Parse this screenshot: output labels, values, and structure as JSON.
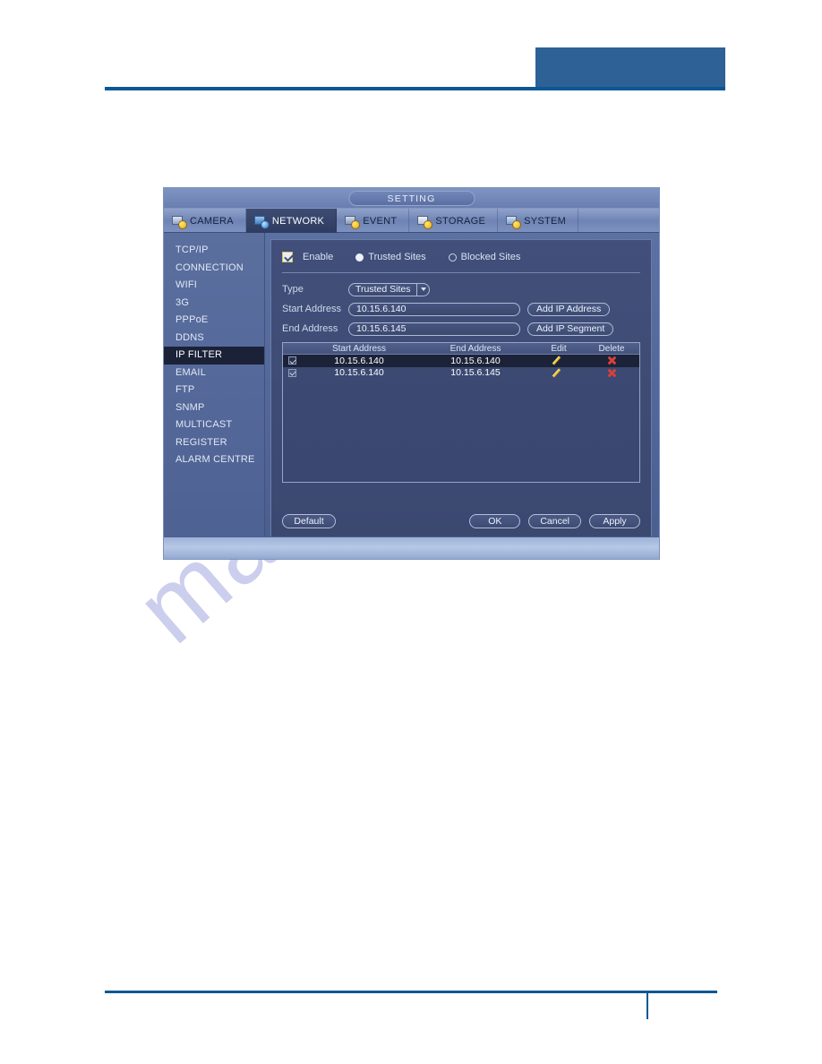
{
  "dialog": {
    "title": "SETTING",
    "tabs": [
      {
        "label": "CAMERA",
        "icon": "camera-icon",
        "active": false
      },
      {
        "label": "NETWORK",
        "icon": "network-icon",
        "active": true
      },
      {
        "label": "EVENT",
        "icon": "event-icon",
        "active": false
      },
      {
        "label": "STORAGE",
        "icon": "storage-icon",
        "active": false
      },
      {
        "label": "SYSTEM",
        "icon": "system-icon",
        "active": false
      }
    ],
    "sidebar": {
      "items": [
        {
          "label": "TCP/IP",
          "active": false
        },
        {
          "label": "CONNECTION",
          "active": false
        },
        {
          "label": "WIFI",
          "active": false
        },
        {
          "label": "3G",
          "active": false
        },
        {
          "label": "PPPoE",
          "active": false
        },
        {
          "label": "DDNS",
          "active": false
        },
        {
          "label": "IP FILTER",
          "active": true
        },
        {
          "label": "EMAIL",
          "active": false
        },
        {
          "label": "FTP",
          "active": false
        },
        {
          "label": "SNMP",
          "active": false
        },
        {
          "label": "MULTICAST",
          "active": false
        },
        {
          "label": "REGISTER",
          "active": false
        },
        {
          "label": "ALARM CENTRE",
          "active": false
        }
      ]
    },
    "form": {
      "enable_label": "Enable",
      "enable_checked": true,
      "mode_trusted_label": "Trusted Sites",
      "mode_blocked_label": "Blocked Sites",
      "mode_selected": "Trusted Sites",
      "type_label": "Type",
      "type_value": "Trusted Sites",
      "type_options": [
        "Trusted Sites",
        "Blocked Sites"
      ],
      "start_label": "Start Address",
      "start_value": "10.15.6.140",
      "end_label": "End Address",
      "end_value": "10.15.6.145",
      "add_ip_address_label": "Add IP Address",
      "add_ip_segment_label": "Add IP Segment"
    },
    "table": {
      "columns": [
        "Start Address",
        "End Address",
        "Edit",
        "Delete"
      ],
      "rows": [
        {
          "checked": true,
          "start": "10.15.6.140",
          "end": "10.15.6.140",
          "selected": true
        },
        {
          "checked": true,
          "start": "10.15.6.140",
          "end": "10.15.6.145",
          "selected": false
        }
      ]
    },
    "footer": {
      "default_label": "Default",
      "ok_label": "OK",
      "cancel_label": "Cancel",
      "apply_label": "Apply"
    }
  },
  "watermark": {
    "text": "manualslive.com"
  },
  "colors": {
    "page_accent": "#0b5793",
    "header_block": "#2e6196",
    "dialog_panel": "#414f7a",
    "active_item": "#1b2238",
    "edit_icon": "#f2c732",
    "delete_icon": "#d8403a",
    "checkbox_border": "#d8c356"
  }
}
